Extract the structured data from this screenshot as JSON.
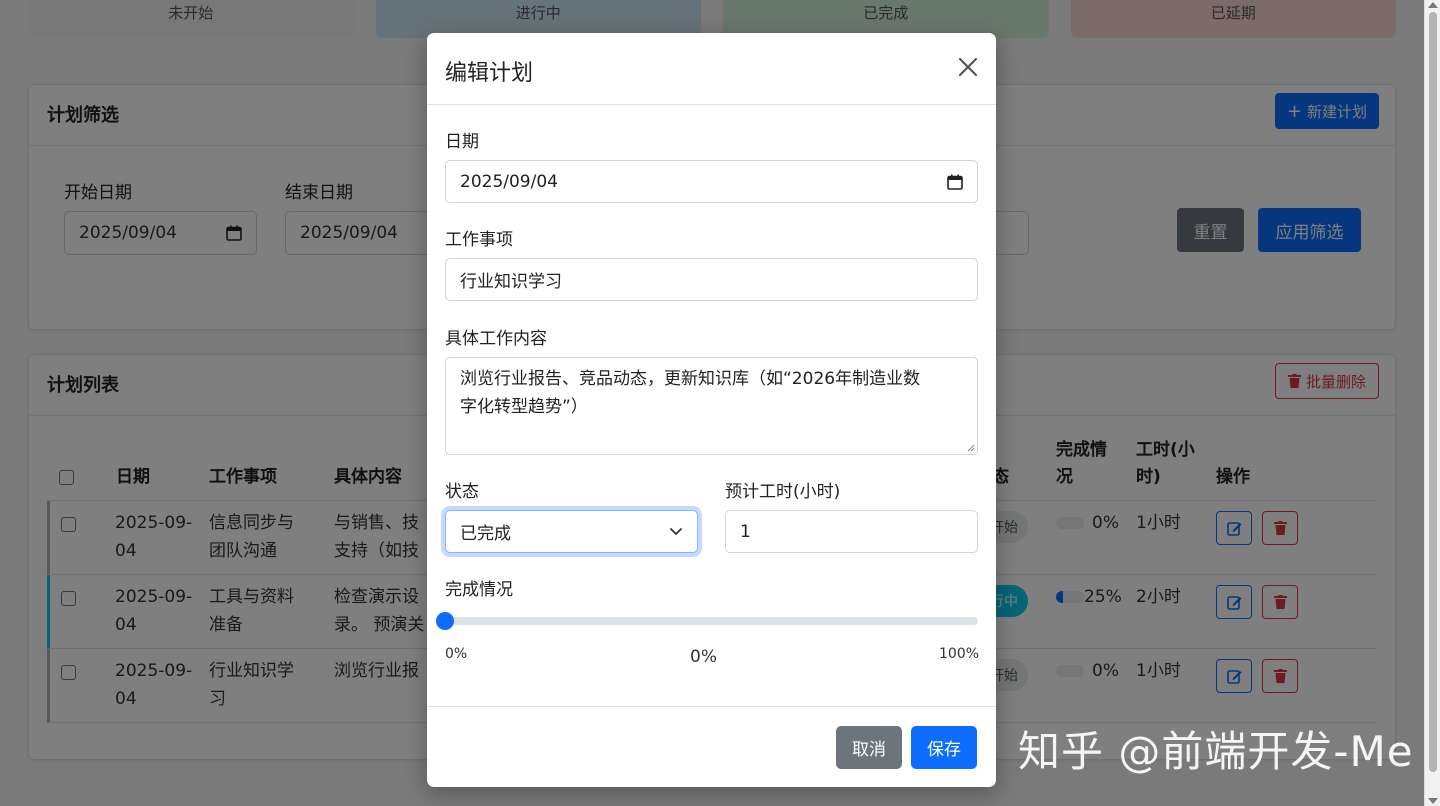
{
  "stats": [
    "未开始",
    "进行中",
    "已完成",
    "已延期"
  ],
  "filter": {
    "title": "计划筛选",
    "new_button": "新建计划",
    "start_label": "开始日期",
    "start_value": "2025/09/04",
    "end_label": "结束日期",
    "end_value": "2025/09/04",
    "reset": "重置",
    "apply": "应用筛选"
  },
  "list": {
    "title": "计划列表",
    "bulk_delete": "批量删除",
    "headers": {
      "date": "日期",
      "item": "工作事项",
      "content": "具体内容",
      "status": "态",
      "progress_l1": "完成情",
      "progress_l2": "况",
      "hours_l1": "工时(小",
      "hours_l2": "时)",
      "actions": "操作"
    },
    "rows": [
      {
        "date_l1": "2025-09-",
        "date_l2": "04",
        "item_l1": "信息同步与",
        "item_l2": "团队沟通",
        "content_l1": "与销售、技",
        "content_l2": "支持（如技",
        "status": "开始",
        "status_type": "grey",
        "progress_label": "0%",
        "progress": 0,
        "hours": "1小时"
      },
      {
        "date_l1": "2025-09-",
        "date_l2": "04",
        "item_l1": "工具与资料",
        "item_l2": "准备",
        "content_l1": "检查演示设",
        "content_l2": "录。 预演关",
        "status": "行中",
        "status_type": "blue",
        "progress_label": "25%",
        "progress": 25,
        "hours": "2小时"
      },
      {
        "date_l1": "2025-09-",
        "date_l2": "04",
        "item_l1": "行业知识学",
        "item_l2": "习",
        "content_l1": "浏览行业报",
        "content_l2": "",
        "status": "开始",
        "status_type": "grey",
        "progress_label": "0%",
        "progress": 0,
        "hours": "1小时"
      }
    ]
  },
  "modal": {
    "title": "编辑计划",
    "date_label": "日期",
    "date_value": "2025/09/04",
    "item_label": "工作事项",
    "item_value": "行业知识学习",
    "content_label": "具体工作内容",
    "content_l1": "浏览行业报告、竞品动态，更新知识库（如“2026年制造业数",
    "content_l2": "字化转型趋势”）",
    "status_label": "状态",
    "status_value": "已完成",
    "hours_label": "预计工时(小时)",
    "hours_value": "1",
    "progress_label": "完成情况",
    "progress_value": 0,
    "progress_min": "0%",
    "progress_current": "0%",
    "progress_max": "100%",
    "cancel": "取消",
    "save": "保存"
  },
  "watermark": "知乎 @前端开发-Me",
  "colors": {
    "primary": "#0d6efd",
    "secondary": "#6c757d",
    "danger": "#dc3545",
    "info": "#0dcaf0"
  }
}
